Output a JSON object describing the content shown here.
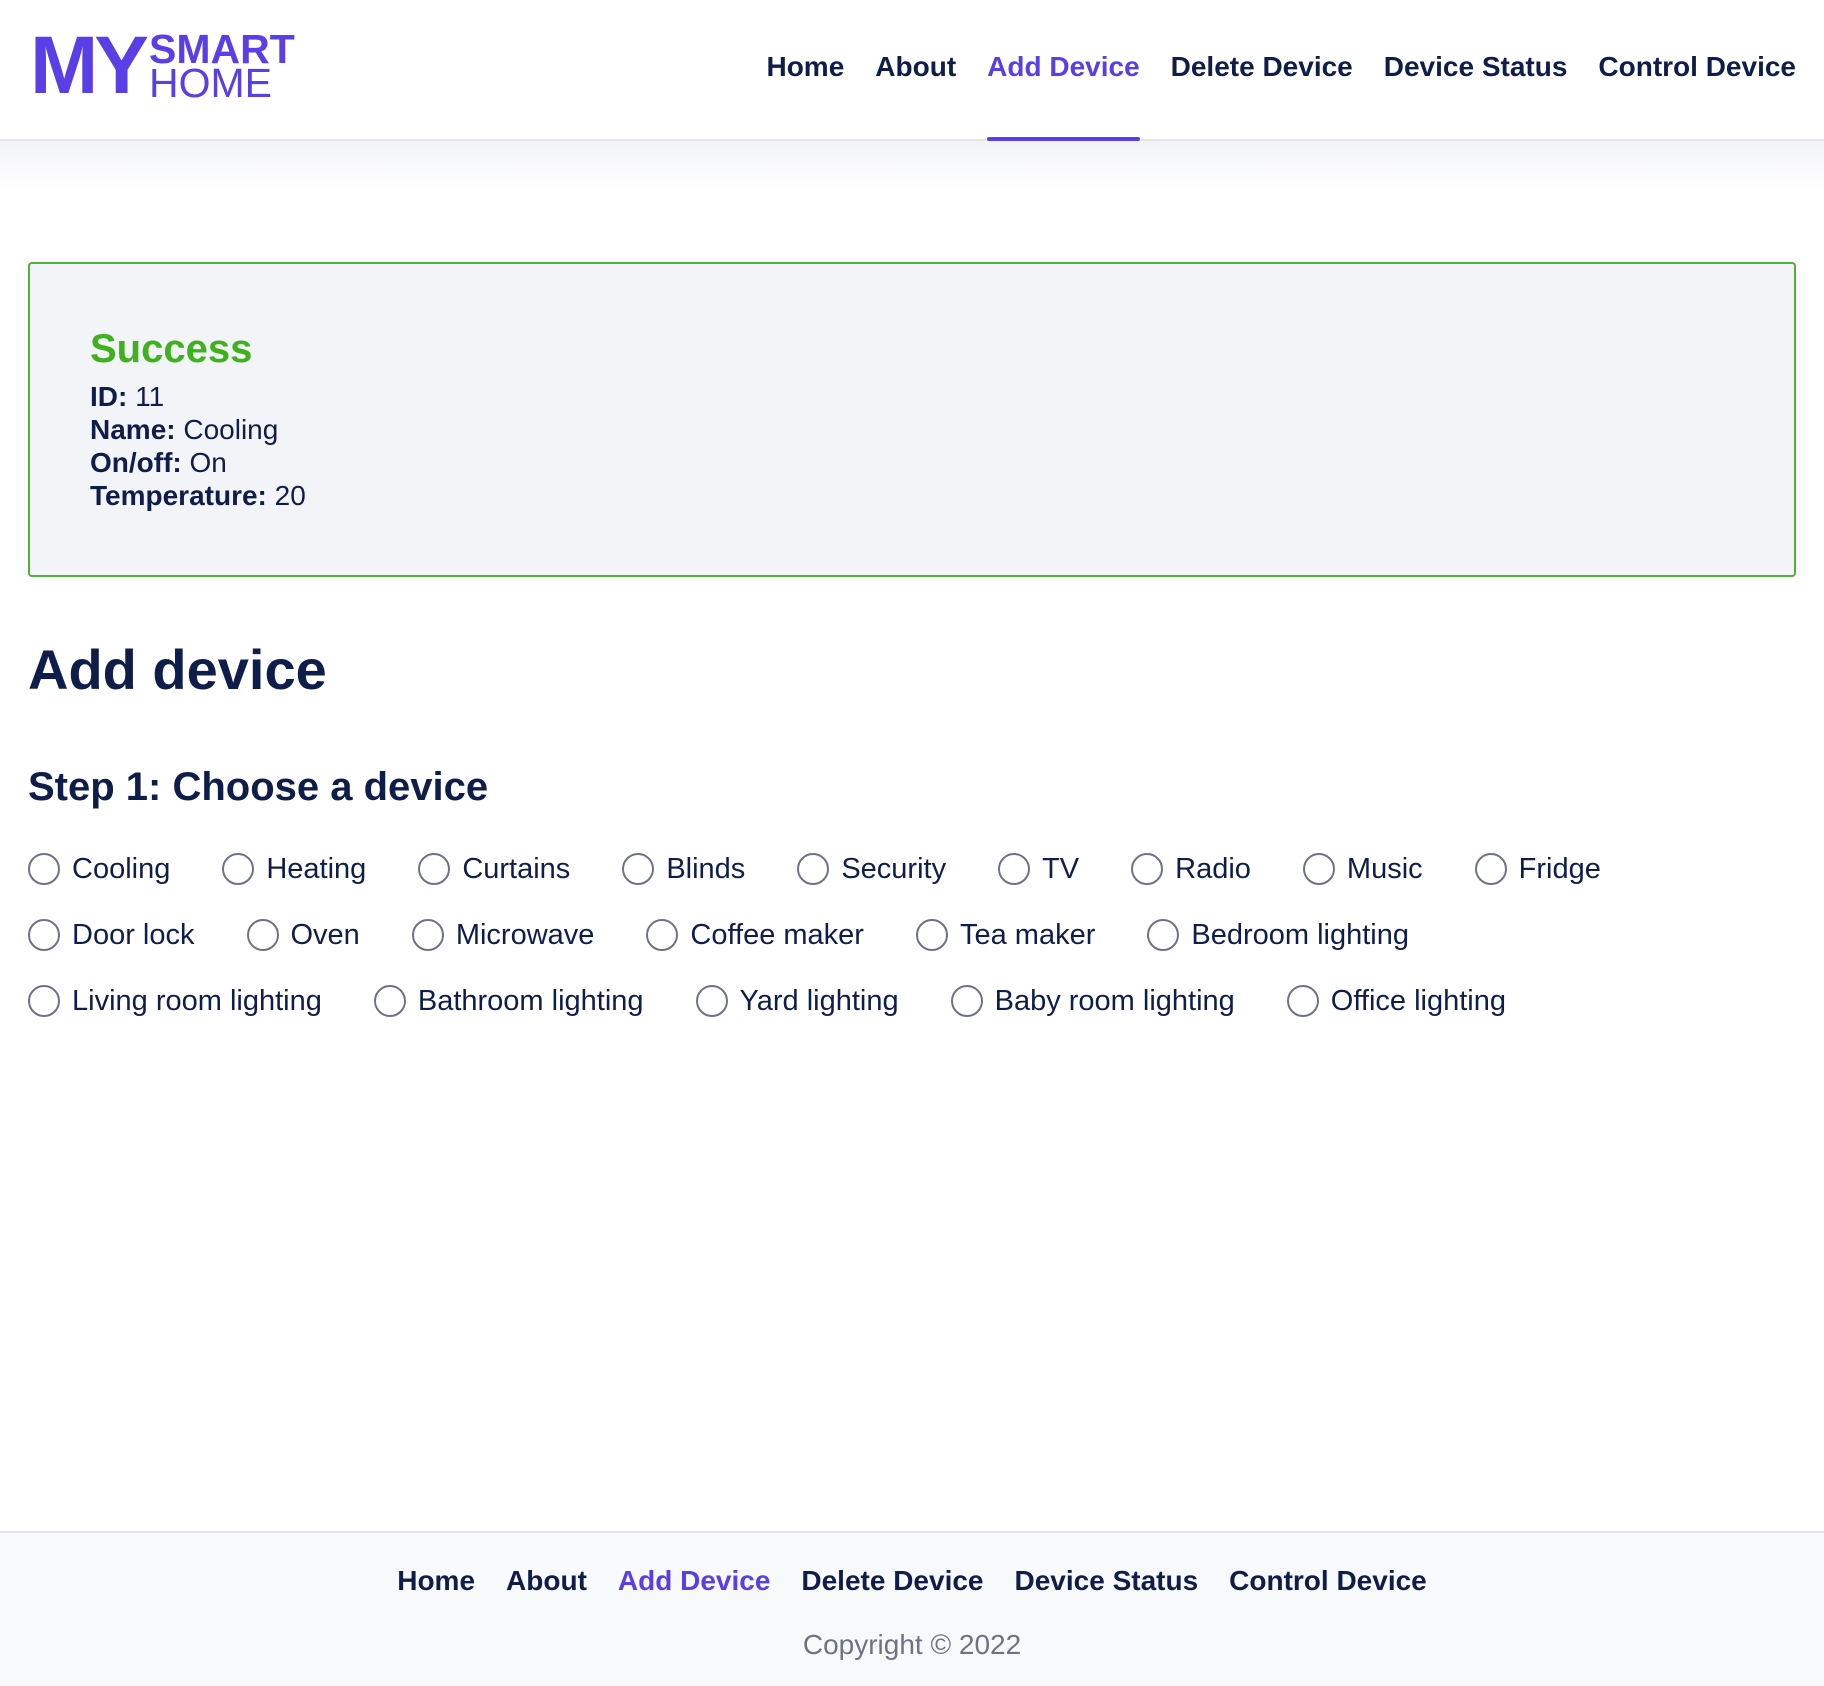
{
  "logo": {
    "my": "MY",
    "smart": "SMART",
    "home": "HOME"
  },
  "nav": [
    {
      "label": "Home",
      "active": false
    },
    {
      "label": "About",
      "active": false
    },
    {
      "label": "Add Device",
      "active": true
    },
    {
      "label": "Delete Device",
      "active": false
    },
    {
      "label": "Device Status",
      "active": false
    },
    {
      "label": "Control Device",
      "active": false
    }
  ],
  "success": {
    "title": "Success",
    "id_label": "ID:",
    "id_value": "11",
    "name_label": "Name:",
    "name_value": "Cooling",
    "onoff_label": "On/off:",
    "onoff_value": "On",
    "temp_label": "Temperature:",
    "temp_value": "20"
  },
  "main": {
    "title": "Add device",
    "step": "Step 1: Choose a device",
    "options": [
      [
        "Cooling",
        "Heating",
        "Curtains",
        "Blinds",
        "Security",
        "TV",
        "Radio",
        "Music",
        "Fridge"
      ],
      [
        "Door lock",
        "Oven",
        "Microwave",
        "Coffee maker",
        "Tea maker",
        "Bedroom lighting"
      ],
      [
        "Living room lighting",
        "Bathroom lighting",
        "Yard lighting",
        "Baby room lighting",
        "Office lighting"
      ]
    ]
  },
  "footer": {
    "nav": [
      {
        "label": "Home",
        "active": false
      },
      {
        "label": "About",
        "active": false
      },
      {
        "label": "Add Device",
        "active": true
      },
      {
        "label": "Delete Device",
        "active": false
      },
      {
        "label": "Device Status",
        "active": false
      },
      {
        "label": "Control Device",
        "active": false
      }
    ],
    "copyright": "Copyright © 2022"
  },
  "colors": {
    "accent": "#5a3fe6",
    "success": "#3fb11d",
    "text": "#0f1d4a"
  }
}
